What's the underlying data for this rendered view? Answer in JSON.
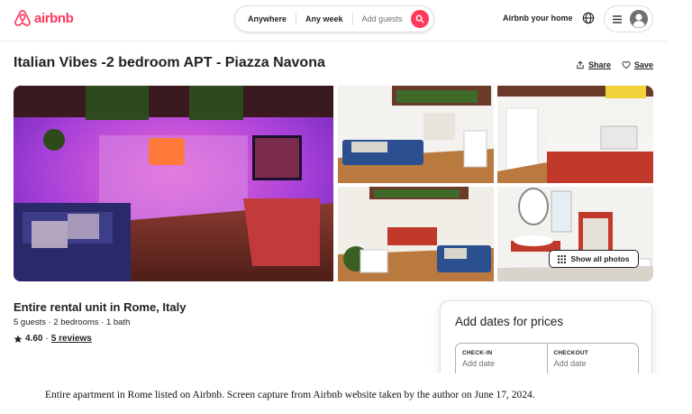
{
  "header": {
    "brand": "airbnb",
    "brand_color": "#ff385c",
    "search": {
      "anywhere": "Anywhere",
      "any_week": "Any week",
      "add_guests": "Add guests",
      "search_icon": "search-icon"
    },
    "host_link": "Airbnb your home",
    "globe_icon": "globe-icon",
    "menu_icon": "hamburger-icon",
    "avatar_icon": "user-avatar-icon"
  },
  "listing": {
    "title": "Italian Vibes -2 bedroom APT - Piazza Navona",
    "share_label": "Share",
    "save_label": "Save",
    "type": "Entire rental unit in Rome, Italy",
    "details": "5 guests · 2 bedrooms · 1 bath",
    "rating": "4.60",
    "separator": "·",
    "reviews": "5 reviews"
  },
  "gallery": {
    "show_all_label": "Show all photos"
  },
  "booking": {
    "title": "Add dates for prices",
    "checkin_label": "CHECK-IN",
    "checkin_value": "Add date",
    "checkout_label": "CHECKOUT",
    "checkout_value": "Add date"
  },
  "caption": "Entire apartment in Rome listed on Airbnb. Screen capture from Airbnb website taken by the author on June 17, 2024."
}
